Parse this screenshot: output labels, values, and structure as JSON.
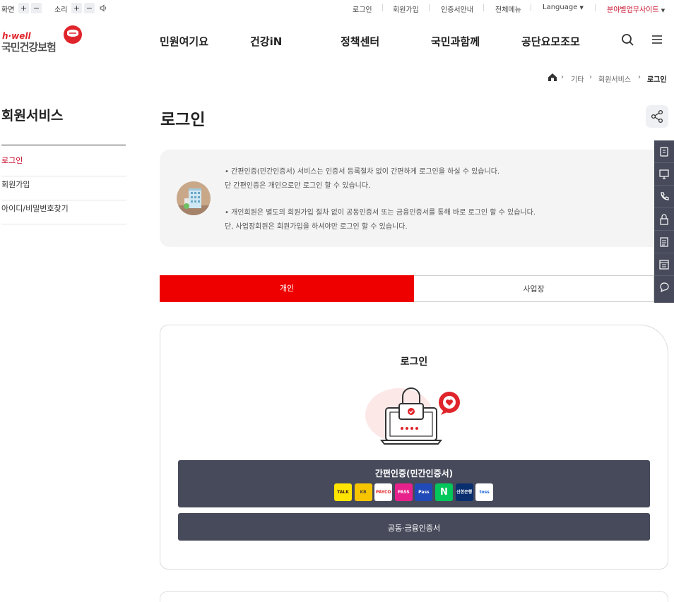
{
  "utility_bar": {
    "screen_label": "화면",
    "sound_label": "소리",
    "plus": "+",
    "minus": "−",
    "links": [
      "로그인",
      "회원가입",
      "인증서안내",
      "전체메뉴"
    ],
    "language_label": "Language",
    "sites_label": "분야별업무사이트"
  },
  "logo": {
    "brand": "h·well",
    "name": "국민건강보험"
  },
  "gnb": [
    "민원여기요",
    "건강iN",
    "정책센터",
    "국민과함께",
    "공단요모조모"
  ],
  "breadcrumb": [
    "기타",
    "회원서비스",
    "로그인"
  ],
  "sidebar": {
    "title": "회원서비스",
    "items": [
      {
        "label": "로그인",
        "active": true
      },
      {
        "label": "회원가입",
        "active": false
      },
      {
        "label": "아이디/비밀번호찾기",
        "active": false
      }
    ]
  },
  "page": {
    "title": "로그인",
    "notice": [
      "• 간편인증(민간인증서) 서비스는 인증서 등록절차 없이 간편하게 로그인을 하실 수 있습니다.",
      "단 간편인증은 개인으로만 로그인 할 수 있습니다.",
      "• 개인회원은 별도의 회원가입 절차 없이 공동인증서 또는 금융인증서를 통해 바로 로그인 할 수 있습니다.",
      "단, 사업장회원은 회원가입을 하셔야만 로그인 할 수 있습니다."
    ],
    "tabs": [
      {
        "label": "개인",
        "active": true
      },
      {
        "label": "사업장",
        "active": false
      }
    ]
  },
  "login": {
    "title": "로그인",
    "simple_auth_label": "간편인증(민간인증서)",
    "cert_label": "공동·금융인증서",
    "providers": [
      {
        "name": "TALK",
        "bg": "#fde500",
        "fg": "#3c1e1e"
      },
      {
        "name": "KB",
        "bg": "#f7c500",
        "fg": "#5a4a2f"
      },
      {
        "name": "PAYCO",
        "bg": "#ffffff",
        "fg": "#e5282b"
      },
      {
        "name": "PASS",
        "bg": "#e7218b",
        "fg": "#ffffff"
      },
      {
        "name": "Pass",
        "bg": "#1f4ab8",
        "fg": "#ffffff"
      },
      {
        "name": "N",
        "bg": "#03c75a",
        "fg": "#ffffff"
      },
      {
        "name": "신한은행",
        "bg": "#0a2f6e",
        "fg": "#ffffff"
      },
      {
        "name": "toss",
        "bg": "#ffffff",
        "fg": "#1b64da"
      }
    ]
  },
  "colors": {
    "accent": "#ee0000",
    "dark_button": "#474a5b",
    "quick_bar": "#464a5a"
  }
}
